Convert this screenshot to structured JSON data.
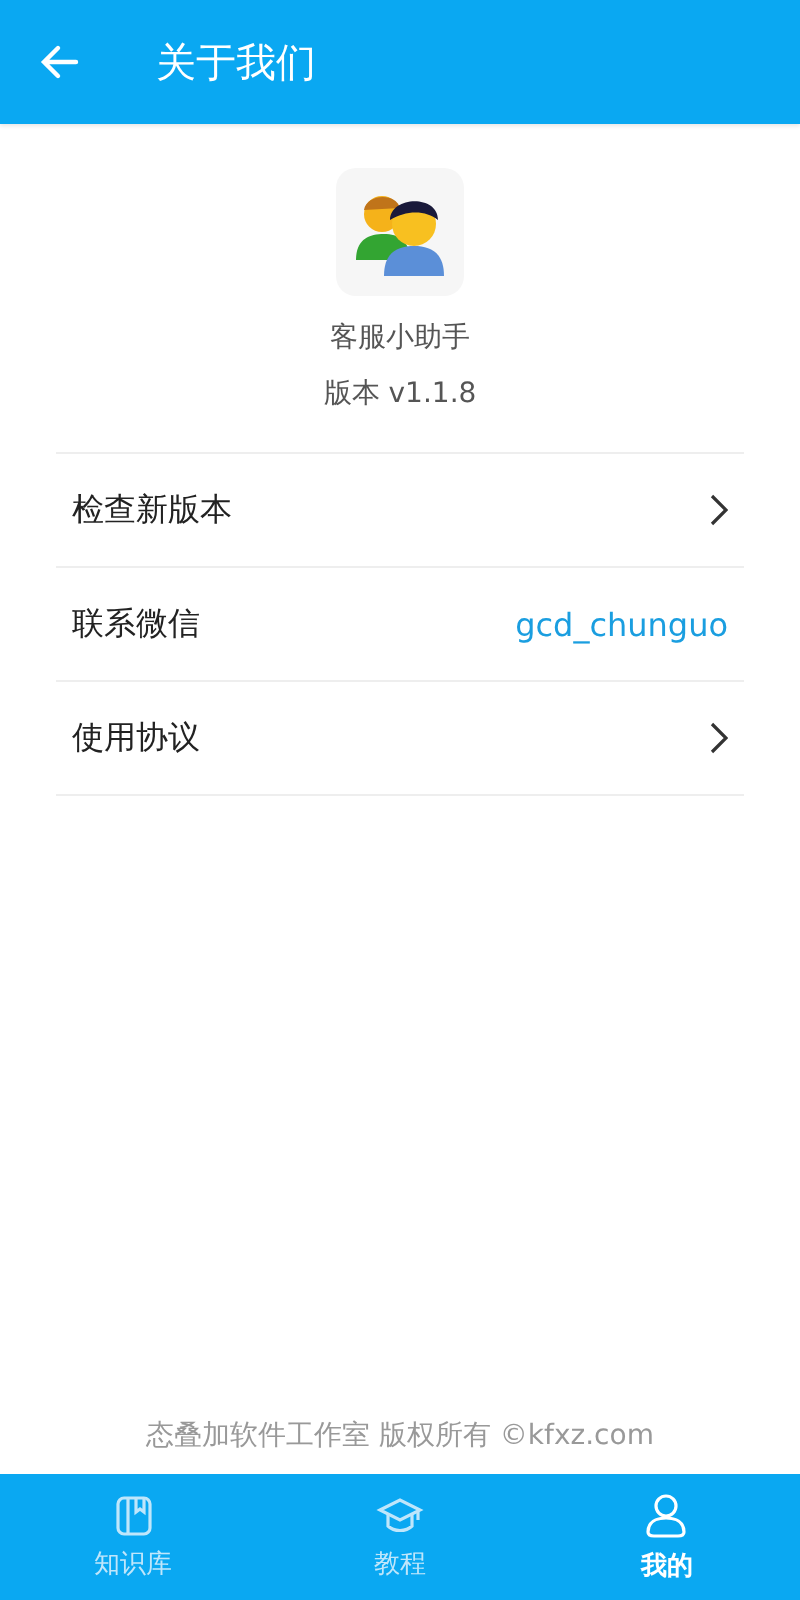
{
  "header": {
    "title": "关于我们"
  },
  "app": {
    "name": "客服小助手",
    "version": "版本 v1.1.8"
  },
  "rows": [
    {
      "kind": "link",
      "label": "检查新版本"
    },
    {
      "kind": "value",
      "label": "联系微信",
      "value": "gcd_chunguo"
    },
    {
      "kind": "link",
      "label": "使用协议"
    }
  ],
  "footer": "态叠加软件工作室 版权所有 ©kfxz.com",
  "tabs": [
    {
      "kind": "book",
      "label": "知识库",
      "selected": false
    },
    {
      "kind": "cap",
      "label": "教程",
      "selected": false
    },
    {
      "kind": "user",
      "label": "我的",
      "selected": true
    }
  ]
}
